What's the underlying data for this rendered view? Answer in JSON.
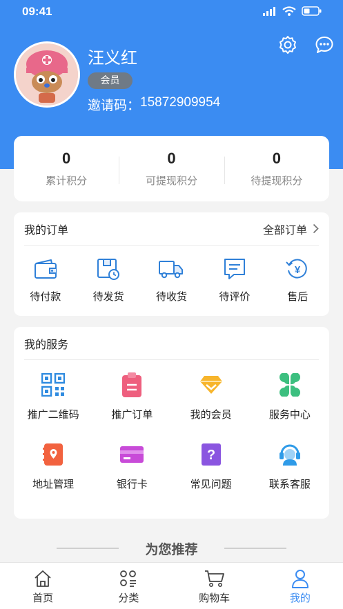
{
  "status_bar": {
    "time": "09:41"
  },
  "profile": {
    "name": "汪义红",
    "badge": "会员",
    "invite_label": "邀请码：",
    "invite_code": "15872909954"
  },
  "points": [
    {
      "value": "0",
      "label": "累计积分"
    },
    {
      "value": "0",
      "label": "可提现积分"
    },
    {
      "value": "0",
      "label": "待提现积分"
    }
  ],
  "orders": {
    "title": "我的订单",
    "all_label": "全部订单",
    "items": [
      {
        "label": "待付款",
        "icon": "wallet-icon"
      },
      {
        "label": "待发货",
        "icon": "box-clock-icon"
      },
      {
        "label": "待收货",
        "icon": "truck-icon"
      },
      {
        "label": "待评价",
        "icon": "comment-icon"
      },
      {
        "label": "售后",
        "icon": "refund-icon"
      }
    ]
  },
  "services": {
    "title": "我的服务",
    "items": [
      {
        "label": "推广二维码",
        "icon": "qrcode-icon"
      },
      {
        "label": "推广订单",
        "icon": "clipboard-icon"
      },
      {
        "label": "我的会员",
        "icon": "diamond-icon"
      },
      {
        "label": "服务中心",
        "icon": "clover-icon"
      },
      {
        "label": "地址管理",
        "icon": "location-book-icon"
      },
      {
        "label": "银行卡",
        "icon": "bank-card-icon"
      },
      {
        "label": "常见问题",
        "icon": "question-icon"
      },
      {
        "label": "联系客服",
        "icon": "customer-service-icon"
      }
    ]
  },
  "recommend": {
    "title": "为您推荐"
  },
  "tabbar": [
    {
      "label": "首页",
      "icon": "home-icon"
    },
    {
      "label": "分类",
      "icon": "category-icon"
    },
    {
      "label": "购物车",
      "icon": "cart-icon"
    },
    {
      "label": "我的",
      "icon": "user-icon",
      "active": true
    }
  ],
  "colors": {
    "primary": "#3b8cf2",
    "background": "#f3f3f3"
  }
}
